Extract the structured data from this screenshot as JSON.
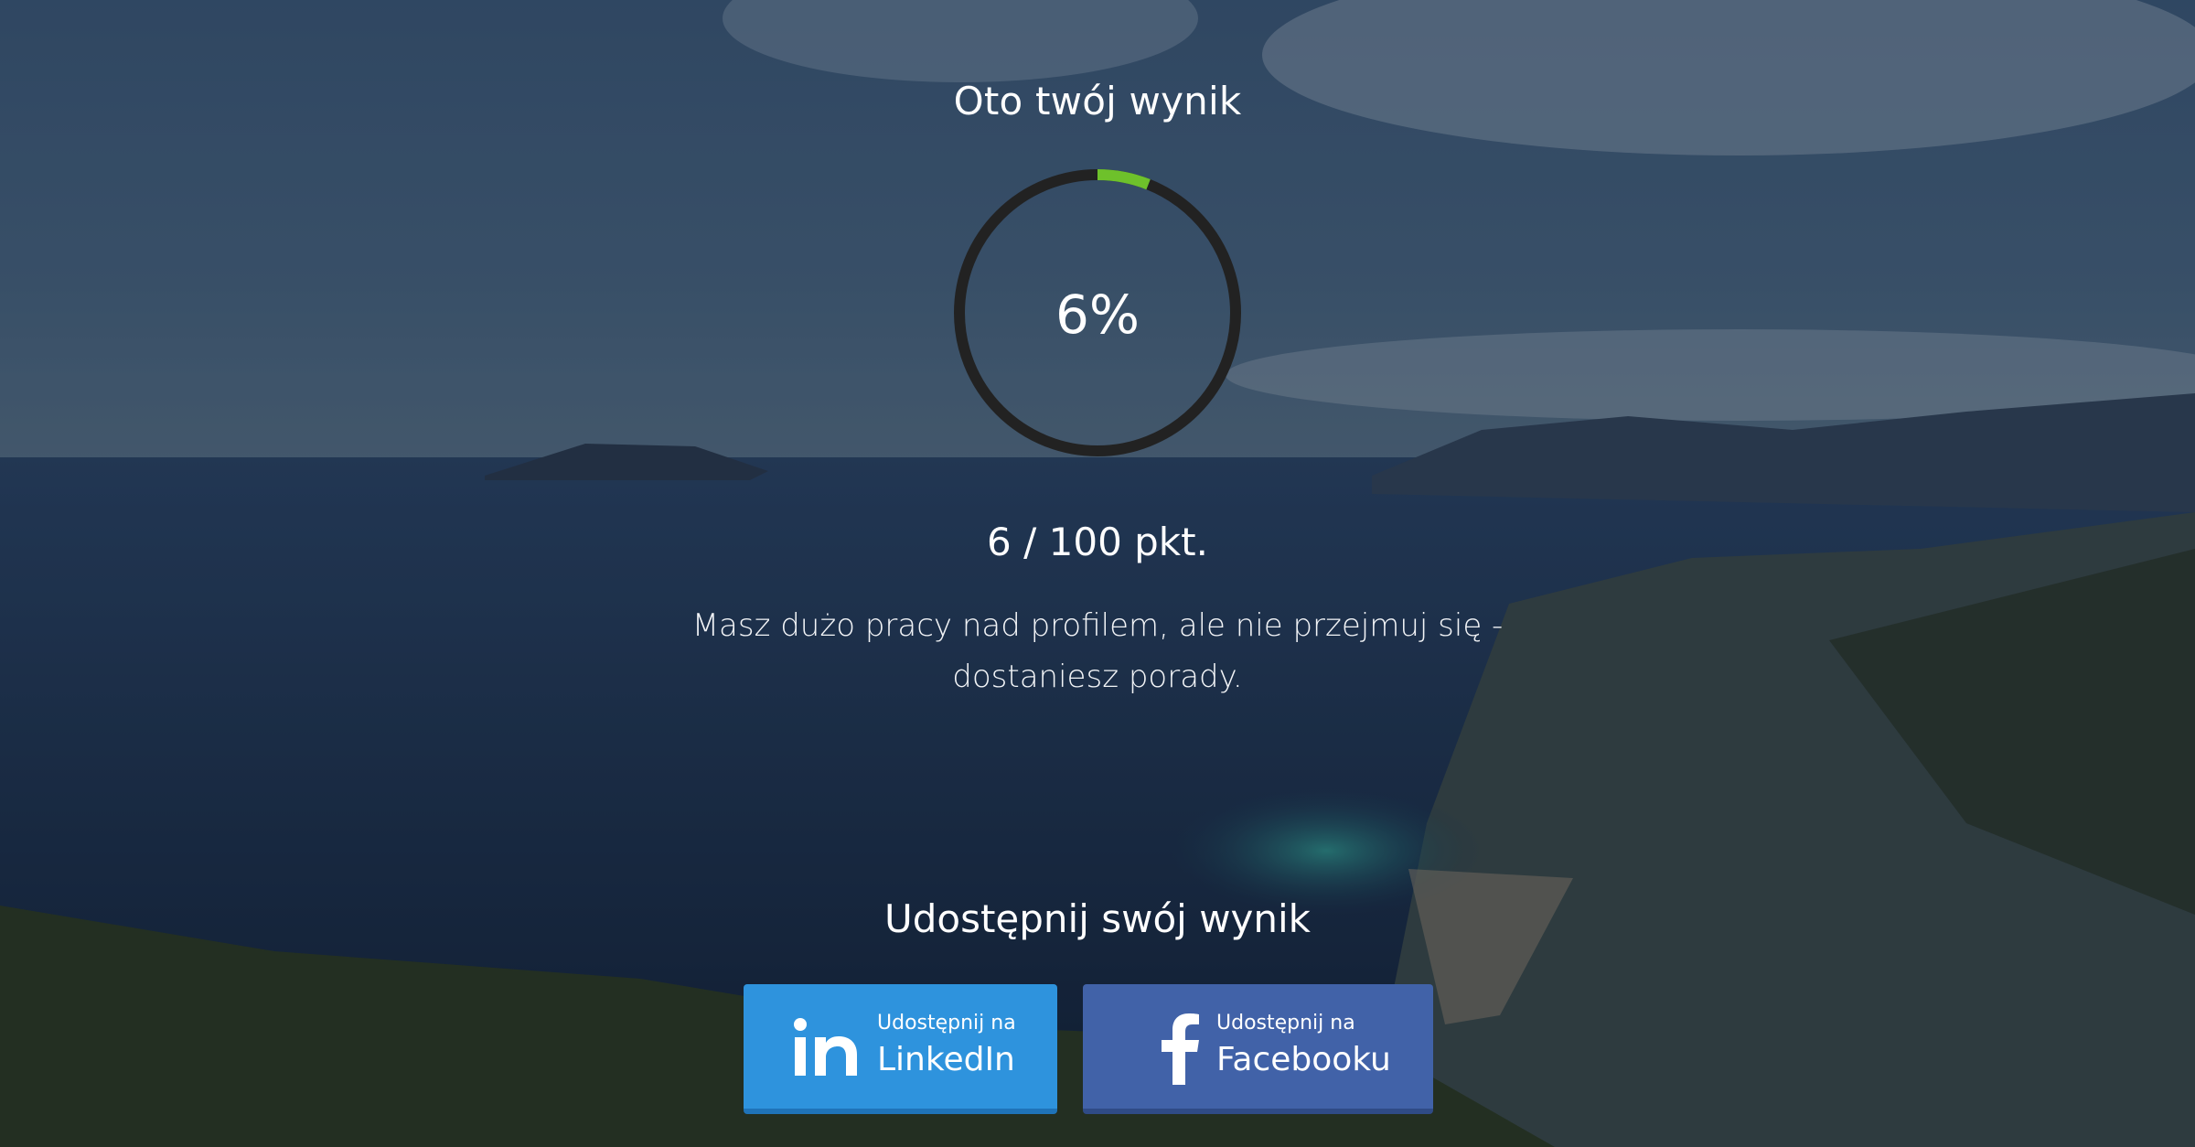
{
  "result": {
    "heading": "Oto twój wynik",
    "percent_text": "6%",
    "percent": 6,
    "score_text": "6 / 100 pkt.",
    "message": "Masz dużo pracy nad profilem, ale nie przejmuj się - dostaniesz porady."
  },
  "share": {
    "heading": "Udostępnij swój wynik",
    "linkedin": {
      "small_label": "Udostępnij na",
      "big_label": "LinkedIn",
      "icon": "linkedin-icon"
    },
    "facebook": {
      "small_label": "Udostępnij na",
      "big_label": "Facebooku",
      "icon": "facebook-icon"
    }
  },
  "colors": {
    "gauge_track": "#222222",
    "gauge_progress": "#6ec12b",
    "linkedin": "#2e93dd",
    "facebook": "#4162a8"
  }
}
